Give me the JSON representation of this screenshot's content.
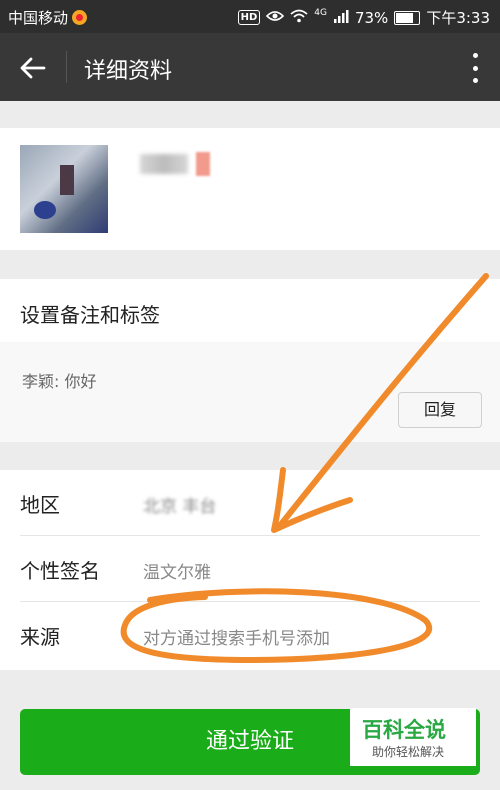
{
  "status_bar": {
    "carrier": "中国移动",
    "network": "4G",
    "battery": "73%",
    "time": "下午3:33"
  },
  "toolbar": {
    "title": "详细资料"
  },
  "remark": {
    "label": "设置备注和标签",
    "message": "李颖: 你好",
    "reply_label": "回复"
  },
  "info": {
    "region_label": "地区",
    "region_value": "北京 丰台",
    "signature_label": "个性签名",
    "signature_value": "温文尔雅",
    "source_label": "来源",
    "source_value": "对方通过搜索手机号添加"
  },
  "actions": {
    "verify_label": "通过验证"
  },
  "watermark": {
    "title": "百科全说",
    "subtitle": "助你轻松解决"
  },
  "colors": {
    "accent": "#1aad19",
    "annotation": "#f08a2a"
  }
}
